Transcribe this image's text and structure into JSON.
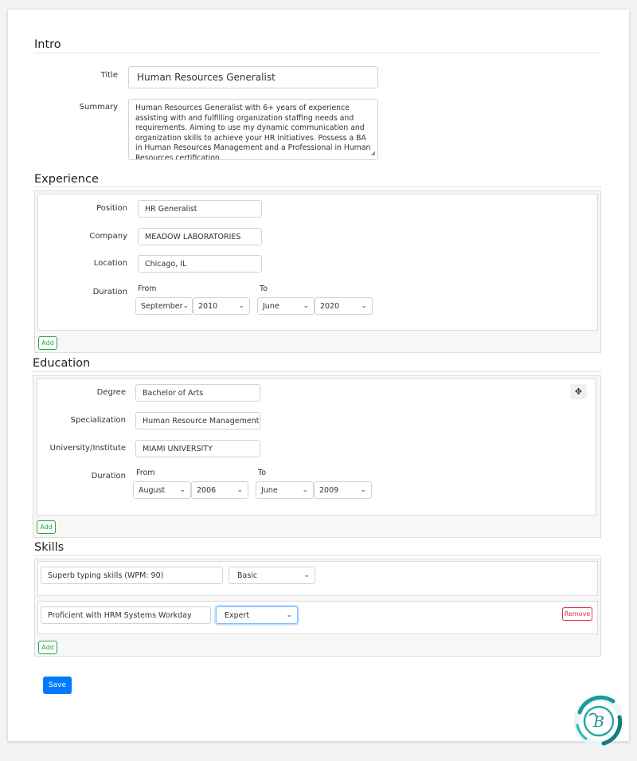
{
  "intro": {
    "heading": "Intro",
    "title_label": "Title",
    "title_value": "Human Resources Generalist",
    "summary_label": "Summary",
    "summary_value": "Human Resources Generalist with 6+ years of experience assisting with and fulfilling organization staffing needs and requirements. Aiming to use my dynamic communication and organization skills to achieve your HR initiatives. Possess a BA in Human Resources Management and a Professional in Human Resources certification."
  },
  "experience": {
    "heading": "Experience",
    "position_label": "Position",
    "position_value": "HR Generalist",
    "company_label": "Company",
    "company_value": "MEADOW LABORATORIES",
    "location_label": "Location",
    "location_value": "Chicago, IL",
    "duration_label": "Duration",
    "from_label": "From",
    "to_label": "To",
    "from_month": "September",
    "from_year": "2010",
    "to_month": "June",
    "to_year": "2020",
    "add_label": "Add"
  },
  "education": {
    "heading": "Education",
    "degree_label": "Degree",
    "degree_value": "Bachelor of Arts",
    "specialization_label": "Specialization",
    "specialization_value": "Human Resource Management",
    "university_label": "University/Institute",
    "university_value": "MIAMI UNIVERSITY",
    "duration_label": "Duration",
    "from_label": "From",
    "to_label": "To",
    "from_month": "August",
    "from_year": "2006",
    "to_month": "June",
    "to_year": "2009",
    "move_icon": "move-icon",
    "add_label": "Add"
  },
  "skills": {
    "heading": "Skills",
    "items": [
      {
        "name": "Superb typing skills (WPM: 90)",
        "level": "Basic"
      },
      {
        "name": "Proficient with HRM Systems Workday",
        "level": "Expert"
      }
    ],
    "remove_label": "Remove",
    "add_label": "Add"
  },
  "save_label": "Save",
  "colors": {
    "primary": "#007bff",
    "success": "#28a745",
    "danger": "#dc3545",
    "logo_teal": "#1a9c9c"
  }
}
